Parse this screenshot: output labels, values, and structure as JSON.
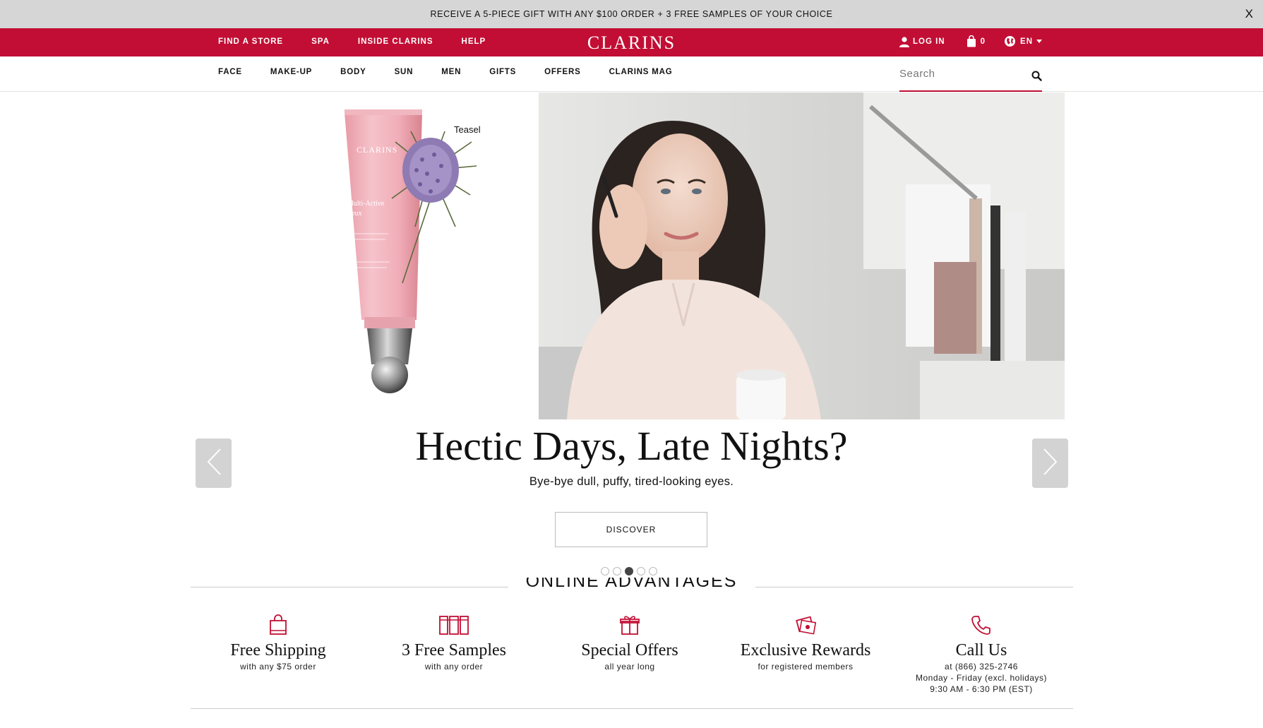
{
  "promo": {
    "text": "RECEIVE A 5-PIECE GIFT WITH ANY $100 ORDER + 3 FREE SAMPLES OF YOUR CHOICE",
    "close": "X"
  },
  "topbar": {
    "links": [
      "FIND A STORE",
      "SPA",
      "INSIDE CLARINS",
      "HELP"
    ],
    "logo": "CLARINS",
    "login": "LOG IN",
    "cart_count": "0",
    "language": "EN",
    "color": "#c20e34"
  },
  "mainnav": {
    "links": [
      "FACE",
      "MAKE-UP",
      "BODY",
      "SUN",
      "MEN",
      "GIFTS",
      "OFFERS",
      "CLARINS MAG"
    ],
    "search_placeholder": "Search"
  },
  "hero": {
    "teasel_label": "Teasel",
    "product_text": {
      "brand": "CLARINS",
      "name": "Multi-Active Yeux"
    },
    "title": "Hectic Days, Late Nights?",
    "subtitle": "Bye-bye dull, puffy, tired-looking eyes.",
    "cta": "DISCOVER",
    "slide_count": 5,
    "active_slide": 3
  },
  "advantages": {
    "heading": "ONLINE ADVANTAGES",
    "items": [
      {
        "icon": "shopping-bag-icon",
        "title": "Free Shipping",
        "sub": [
          "with any $75 order"
        ]
      },
      {
        "icon": "samples-icon",
        "title": "3 Free Samples",
        "sub": [
          "with any order"
        ]
      },
      {
        "icon": "gift-icon",
        "title": "Special Offers",
        "sub": [
          "all year long"
        ]
      },
      {
        "icon": "rewards-card-icon",
        "title": "Exclusive Rewards",
        "sub": [
          "for registered members"
        ]
      },
      {
        "icon": "phone-icon",
        "title": "Call Us",
        "sub": [
          "at (866) 325-2746",
          "Monday - Friday (excl. holidays)",
          "9:30 AM - 6:30 PM (EST)"
        ]
      }
    ]
  }
}
